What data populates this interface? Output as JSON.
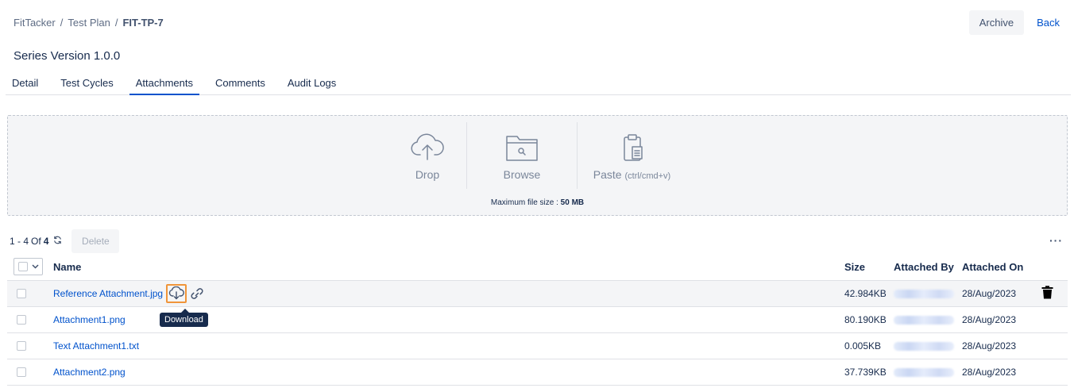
{
  "breadcrumb": {
    "root": "FitTacker",
    "sep": "/",
    "middle": "Test Plan",
    "current": "FIT-TP-7"
  },
  "actions": {
    "archive": "Archive",
    "back": "Back"
  },
  "page_title": "Series Version 1.0.0",
  "tabs": [
    {
      "label": "Detail"
    },
    {
      "label": "Test Cycles"
    },
    {
      "label": "Attachments",
      "active": true
    },
    {
      "label": "Comments"
    },
    {
      "label": "Audit Logs"
    }
  ],
  "dropzone": {
    "drop": "Drop",
    "browse": "Browse",
    "paste": "Paste",
    "paste_hint": "(ctrl/cmd+v)",
    "max_label": "Maximum file size :",
    "max_value": "50 MB"
  },
  "toolbar": {
    "range": "1 - 4",
    "of": "Of",
    "total": "4",
    "delete": "Delete",
    "more": "···"
  },
  "table": {
    "headers": {
      "name": "Name",
      "size": "Size",
      "attached_by": "Attached By",
      "attached_on": "Attached On"
    },
    "rows": [
      {
        "name": "Reference Attachment.jpg",
        "size": "42.984KB",
        "attached_on": "28/Aug/2023"
      },
      {
        "name": "Attachment1.png",
        "size": "80.190KB",
        "attached_on": "28/Aug/2023"
      },
      {
        "name": "Text Attachment1.txt",
        "size": "0.005KB",
        "attached_on": "28/Aug/2023"
      },
      {
        "name": "Attachment2.png",
        "size": "37.739KB",
        "attached_on": "28/Aug/2023"
      }
    ]
  },
  "tooltip": "Download",
  "icons": {
    "upload": "cloud-upload-icon",
    "browse": "folder-search-icon",
    "paste": "clipboard-icon",
    "refresh": "refresh-icon",
    "download": "cloud-download-icon",
    "link": "link-icon",
    "delete": "trash-icon"
  },
  "colors": {
    "link": "#0052cc",
    "highlight_border": "#f0953a",
    "tooltip_bg": "#172b4d"
  }
}
